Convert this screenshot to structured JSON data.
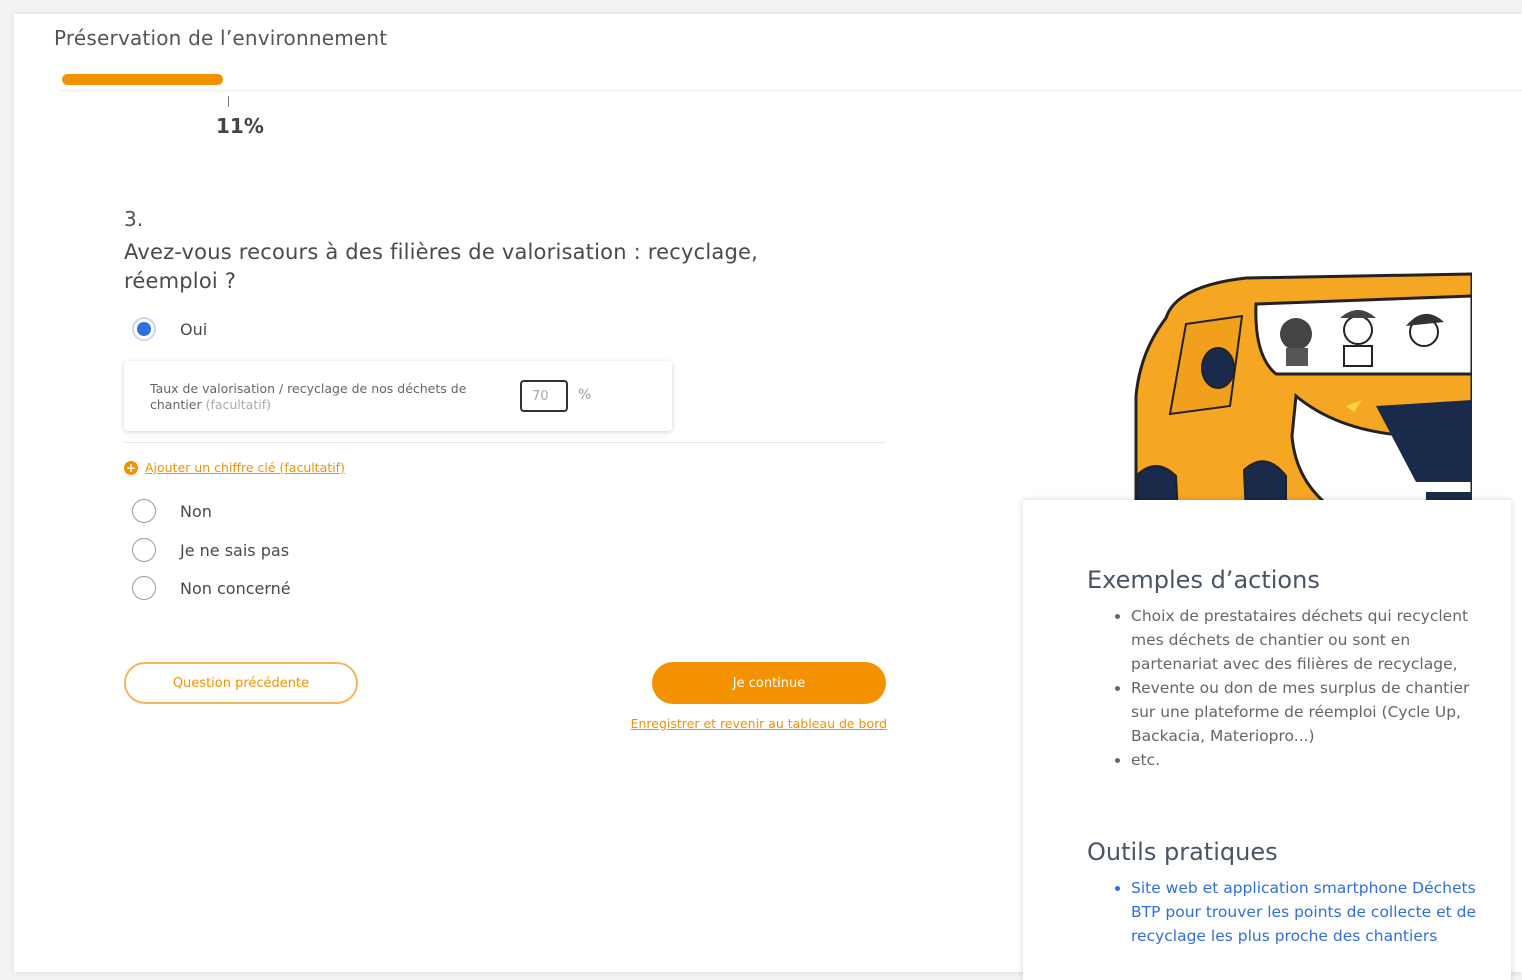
{
  "header": {
    "section_title": "Préservation de l’environnement"
  },
  "progress": {
    "percent": 11,
    "label": "11%",
    "color": "#f39200"
  },
  "question": {
    "number": "3.",
    "text": "Avez-vous recours à des filières de valorisation : recyclage, réemploi ?",
    "options": [
      {
        "label": "Oui",
        "selected": true
      },
      {
        "label": "Non",
        "selected": false
      },
      {
        "label": "Je ne sais pas",
        "selected": false
      },
      {
        "label": "Non concerné",
        "selected": false
      }
    ],
    "sub_field": {
      "label": "Taux de valorisation / recyclage de nos déchets de chantier",
      "optional": "(facultatif)",
      "value": "70",
      "unit": "%"
    },
    "add_key_figure": "Ajouter un chiffre clé (facultatif)"
  },
  "buttons": {
    "previous": "Question précédente",
    "continue": "Je continue",
    "save_link": "Enregistrer et revenir au tableau de bord"
  },
  "tips": {
    "examples_title": "Exemples d’actions",
    "examples": [
      "Choix de prestataires déchets qui recyclent mes déchets de chantier ou sont en partenariat avec des filières de recyclage,",
      "Revente ou don de mes surplus de chantier sur une plateforme de réemploi (Cycle Up, Backacia, Materiopro...)",
      "etc."
    ],
    "tools_title": "Outils pratiques",
    "tools": [
      "Site web et application smartphone Déchets BTP pour trouver les points de collecte et de recyclage les plus proche des chantiers"
    ]
  },
  "colors": {
    "accent": "#f39200",
    "radio": "#2f6fe0",
    "link": "#2f6fe0",
    "van": "#f5a623"
  },
  "icons": {
    "add": "plus-circle-icon",
    "illustration": "van-illustration"
  }
}
